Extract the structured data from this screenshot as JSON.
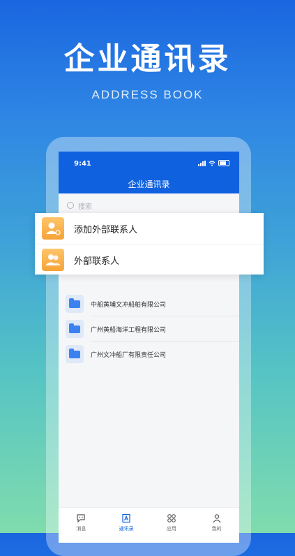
{
  "hero": {
    "title": "企业通讯录",
    "subtitle": "ADDRESS BOOK"
  },
  "status_bar": {
    "time": "9:41"
  },
  "screen_title": "企业通讯录",
  "search": {
    "placeholder": "搜索"
  },
  "popup": {
    "items": [
      {
        "label": "添加外部联系人",
        "icon": "add-contact-icon"
      },
      {
        "label": "外部联系人",
        "icon": "contacts-icon"
      }
    ]
  },
  "companies": [
    {
      "name": "中船黄埔文冲船舶有限公司",
      "icon": "folder-icon"
    },
    {
      "name": "广州黄船海洋工程有限公司",
      "icon": "folder-icon"
    },
    {
      "name": "广州文冲船厂有限责任公司",
      "icon": "folder-icon"
    }
  ],
  "tabbar": {
    "items": [
      {
        "label": "消息",
        "icon": "message-icon"
      },
      {
        "label": "通讯录",
        "icon": "address-book-icon"
      },
      {
        "label": "应用",
        "icon": "apps-icon"
      },
      {
        "label": "我的",
        "icon": "user-icon"
      }
    ],
    "active": "通讯录"
  },
  "colors": {
    "primary": "#1061e0",
    "accent_orange": "#f5a338",
    "folder_blue": "#3b82f0"
  }
}
